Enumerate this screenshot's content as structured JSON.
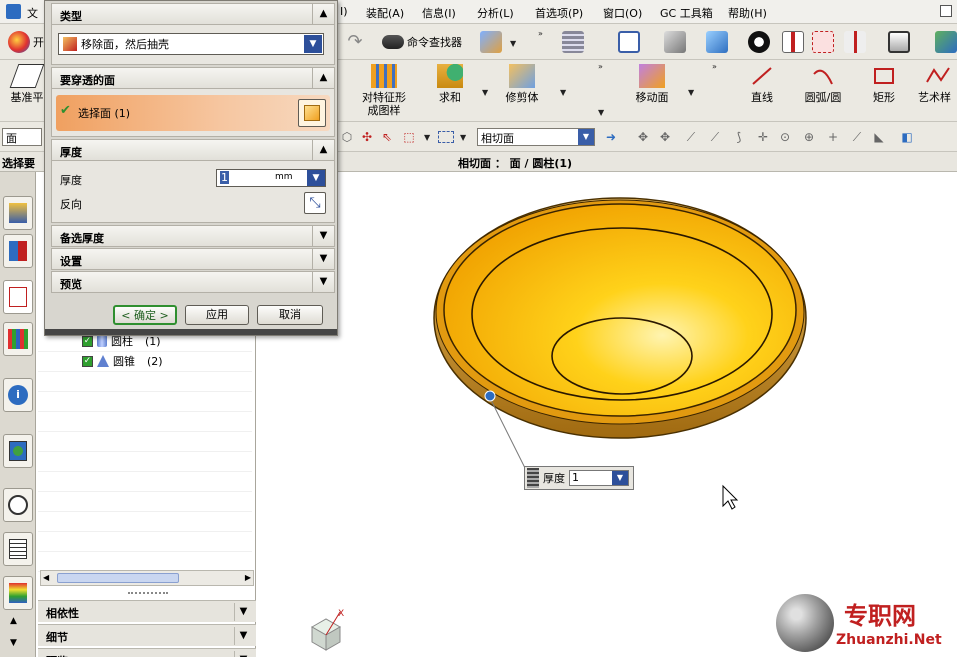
{
  "menubar": {
    "items": [
      "文",
      "I)",
      "装配(A)",
      "信息(I)",
      "分析(L)",
      "首选项(P)",
      "窗口(O)",
      "GC 工具箱",
      "帮助(H)"
    ]
  },
  "toolbar1": {
    "left_label": "开",
    "command_finder": "命令查找器"
  },
  "toolbar2": {
    "datum_plane": "基准平",
    "pattern_feature_l1": "对特征形",
    "pattern_feature_l2": "成图样",
    "unite": "求和",
    "trim_body": "修剪体",
    "move_face": "移动面",
    "line": "直线",
    "arc_circle": "圆弧/圆",
    "rectangle": "矩形",
    "studio_spline": "艺术样"
  },
  "selbar": {
    "filter_value": "面",
    "rule_value": "相切面"
  },
  "statusbar": {
    "prompt": "选择要",
    "message": "相切面 ： 面 / 圆柱(1)"
  },
  "navigator": {
    "tree": [
      {
        "label": "圆柱",
        "count": "(1)"
      },
      {
        "label": "圆锥",
        "count": "(2)"
      }
    ],
    "bottom_panels": [
      "相依性",
      "细节",
      "预览"
    ]
  },
  "dialog": {
    "type_header": "类型",
    "type_value": "移除面，然后抽壳",
    "faces_header": "要穿透的面",
    "select_face": "选择面 (1)",
    "thickness_header": "厚度",
    "thickness_label": "厚度",
    "thickness_value": "1",
    "thickness_unit": "mm",
    "reverse_label": "反向",
    "alt_thickness_header": "备选厚度",
    "settings_header": "设置",
    "preview_header": "预览",
    "ok_button": "< 确定 >",
    "apply_button": "应用",
    "cancel_button": "取消"
  },
  "graphics": {
    "screen_label": "厚度",
    "screen_value": "1"
  },
  "watermark": {
    "cn": "专职网",
    "en": "Zhuanzhi.Net"
  },
  "colors": {
    "part_yellow": "#f5b800",
    "part_rim": "#b87a10",
    "select_face_bg": "#f0a060",
    "ok_border": "#2f8f2f"
  }
}
